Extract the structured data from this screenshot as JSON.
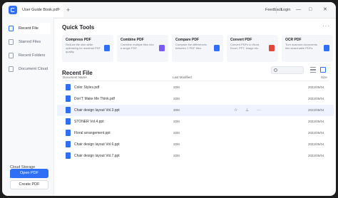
{
  "titlebar": {
    "tab_label": "User Guide Book.pdf",
    "tab_close": "×",
    "new_tab": "+",
    "feedback": "Feedback",
    "login": "Login",
    "minimize": "—",
    "maximize": "□",
    "close": "✕"
  },
  "sidebar": {
    "items": [
      {
        "label": "Recent File",
        "icon": "recent-file-icon"
      },
      {
        "label": "Starred Files",
        "icon": "star-file-icon"
      },
      {
        "label": "Recent Folders",
        "icon": "folder-icon"
      },
      {
        "label": "Document Cloud",
        "icon": "cloud-icon"
      }
    ],
    "storage_title": "Cloud Storage",
    "storage_text": "779.04KB / 1.00GB",
    "storage_fraction": 0.02,
    "open_pdf": "Open PDF",
    "create_pdf": "Create PDF"
  },
  "quick_tools": {
    "title": "Quick Tools",
    "more": "···",
    "cards": [
      {
        "title": "Compress PDF",
        "desc": "Reduce file size while optimizing for maximal PDF quality.",
        "color": "#2f6ff6"
      },
      {
        "title": "Combine PDF",
        "desc": "Combine multiple files into a single PDF.",
        "color": "#7a5af5"
      },
      {
        "title": "Compare PDF",
        "desc": "Compare the differences between 2 PDF files.",
        "color": "#2f6ff6"
      },
      {
        "title": "Convert PDF",
        "desc": "Convert PDFs to Word, Excel, PPT, Image etc.",
        "color": "#e0463a"
      },
      {
        "title": "OCR PDF",
        "desc": "Turn scanned documents into searchable PDFs.",
        "color": "#2f6ff6"
      }
    ]
  },
  "recent": {
    "title": "Recent File",
    "search_placeholder": "",
    "columns": {
      "name": "Document Name",
      "modified": "Last Modified",
      "size": "Size"
    },
    "rows": [
      {
        "name": "Color Styles.pdf",
        "modified": "20M",
        "date": "2022/05/04",
        "color": "#2f6ff6"
      },
      {
        "name": "Don'T Make Me Think.pdf",
        "modified": "20M",
        "date": "2022/05/04",
        "color": "#2f6ff6"
      },
      {
        "name": "Chair design layout Vol.3.ppt",
        "modified": "30M",
        "date": "2022/05/04",
        "color": "#2f6ff6"
      },
      {
        "name": "STONER Vol.4.ppt",
        "modified": "20M",
        "date": "2022/05/04",
        "color": "#2f6ff6"
      },
      {
        "name": "Floral arrangement.ppt",
        "modified": "20M",
        "date": "2022/05/04",
        "color": "#2f6ff6"
      },
      {
        "name": "Chair design layout Vol.6.ppt",
        "modified": "20M",
        "date": "2022/05/04",
        "color": "#2f6ff6"
      },
      {
        "name": "Chair design layout Vol.7.ppt",
        "modified": "20M",
        "date": "2022/05/04",
        "color": "#2f6ff6"
      }
    ],
    "row_actions": {
      "star": "☆",
      "pin": "⊥",
      "more": "···"
    }
  }
}
